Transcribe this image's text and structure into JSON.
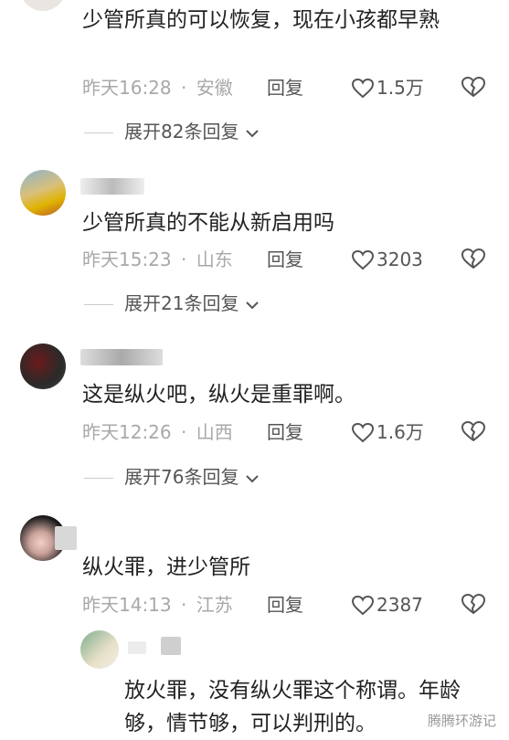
{
  "comments": [
    {
      "text": "少管所真的可以恢复，现在小孩都早熟",
      "time": "昨天16:28",
      "location": "安徽",
      "reply_label": "回复",
      "likes": "1.5万",
      "expand": "展开82条回复"
    },
    {
      "text": "少管所真的不能从新启用吗",
      "time": "昨天15:23",
      "location": "山东",
      "reply_label": "回复",
      "likes": "3203",
      "expand": "展开21条回复"
    },
    {
      "text": "这是纵火吧，纵火是重罪啊。",
      "time": "昨天12:26",
      "location": "山西",
      "reply_label": "回复",
      "likes": "1.6万",
      "expand": "展开76条回复"
    },
    {
      "text": "纵火罪，进少管所",
      "time": "昨天14:13",
      "location": "江苏",
      "reply_label": "回复",
      "likes": "2387"
    },
    {
      "text": "放火罪，没有纵火罪这个称谓。年龄够，情节够，可以判刑的。"
    }
  ],
  "watermark": "腾腾环游记",
  "separator": "·",
  "colors": {
    "meta": "#a8a8a8",
    "text": "#222222",
    "action": "#555555"
  }
}
